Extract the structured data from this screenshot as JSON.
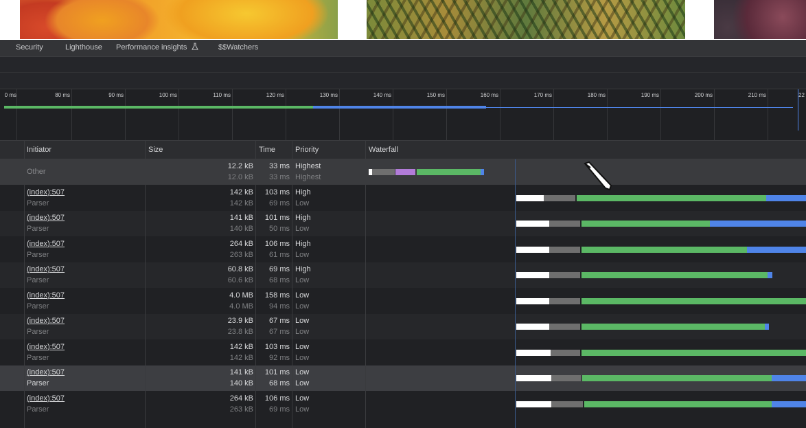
{
  "tabs": [
    "Security",
    "Lighthouse",
    "Performance insights",
    "$$Watchers"
  ],
  "ruler_ticks": [
    "0 ms",
    "80 ms",
    "90 ms",
    "100 ms",
    "110 ms",
    "120 ms",
    "130 ms",
    "140 ms",
    "150 ms",
    "160 ms",
    "170 ms",
    "180 ms",
    "190 ms",
    "200 ms",
    "210 ms",
    "22"
  ],
  "headers": {
    "initiator": "Initiator",
    "size": "Size",
    "time": "Time",
    "priority": "Priority",
    "waterfall": "Waterfall"
  },
  "rows": [
    {
      "initiator": "Other",
      "initiator2": "",
      "size1": "12.2 kB",
      "size2": "12.0 kB",
      "time1": "33 ms",
      "time2": "33 ms",
      "prio1": "Highest",
      "prio2": "Highest"
    },
    {
      "initiator": "(index):507",
      "initiator2": "Parser",
      "size1": "142 kB",
      "size2": "142 kB",
      "time1": "103 ms",
      "time2": "69 ms",
      "prio1": "High",
      "prio2": "Low"
    },
    {
      "initiator": "(index):507",
      "initiator2": "Parser",
      "size1": "141 kB",
      "size2": "140 kB",
      "time1": "101 ms",
      "time2": "50 ms",
      "prio1": "High",
      "prio2": "Low"
    },
    {
      "initiator": "(index):507",
      "initiator2": "Parser",
      "size1": "264 kB",
      "size2": "263 kB",
      "time1": "106 ms",
      "time2": "61 ms",
      "prio1": "High",
      "prio2": "Low"
    },
    {
      "initiator": "(index):507",
      "initiator2": "Parser",
      "size1": "60.8 kB",
      "size2": "60.6 kB",
      "time1": "69 ms",
      "time2": "68 ms",
      "prio1": "High",
      "prio2": "Low"
    },
    {
      "initiator": "(index):507",
      "initiator2": "Parser",
      "size1": "4.0 MB",
      "size2": "4.0 MB",
      "time1": "158 ms",
      "time2": "94 ms",
      "prio1": "Low",
      "prio2": "Low"
    },
    {
      "initiator": "(index):507",
      "initiator2": "Parser",
      "size1": "23.9 kB",
      "size2": "23.8 kB",
      "time1": "67 ms",
      "time2": "67 ms",
      "prio1": "Low",
      "prio2": "Low"
    },
    {
      "initiator": "(index):507",
      "initiator2": "Parser",
      "size1": "142 kB",
      "size2": "142 kB",
      "time1": "103 ms",
      "time2": "92 ms",
      "prio1": "Low",
      "prio2": "Low"
    },
    {
      "initiator": "(index):507",
      "initiator2": "Parser",
      "size1": "141 kB",
      "size2": "140 kB",
      "time1": "101 ms",
      "time2": "68 ms",
      "prio1": "Low",
      "prio2": "Low"
    },
    {
      "initiator": "(index):507",
      "initiator2": "Parser",
      "size1": "264 kB",
      "size2": "263 kB",
      "time1": "106 ms",
      "time2": "69 ms",
      "prio1": "Low",
      "prio2": "Low"
    }
  ],
  "colors": {
    "waiting": "#ffffff",
    "queue": "#6f6f6f",
    "receive": "#5bb865",
    "download": "#4f84e8",
    "dns": "#b27cd9",
    "overview_green": "#5bb865",
    "overview_blue": "#4f84e8"
  }
}
